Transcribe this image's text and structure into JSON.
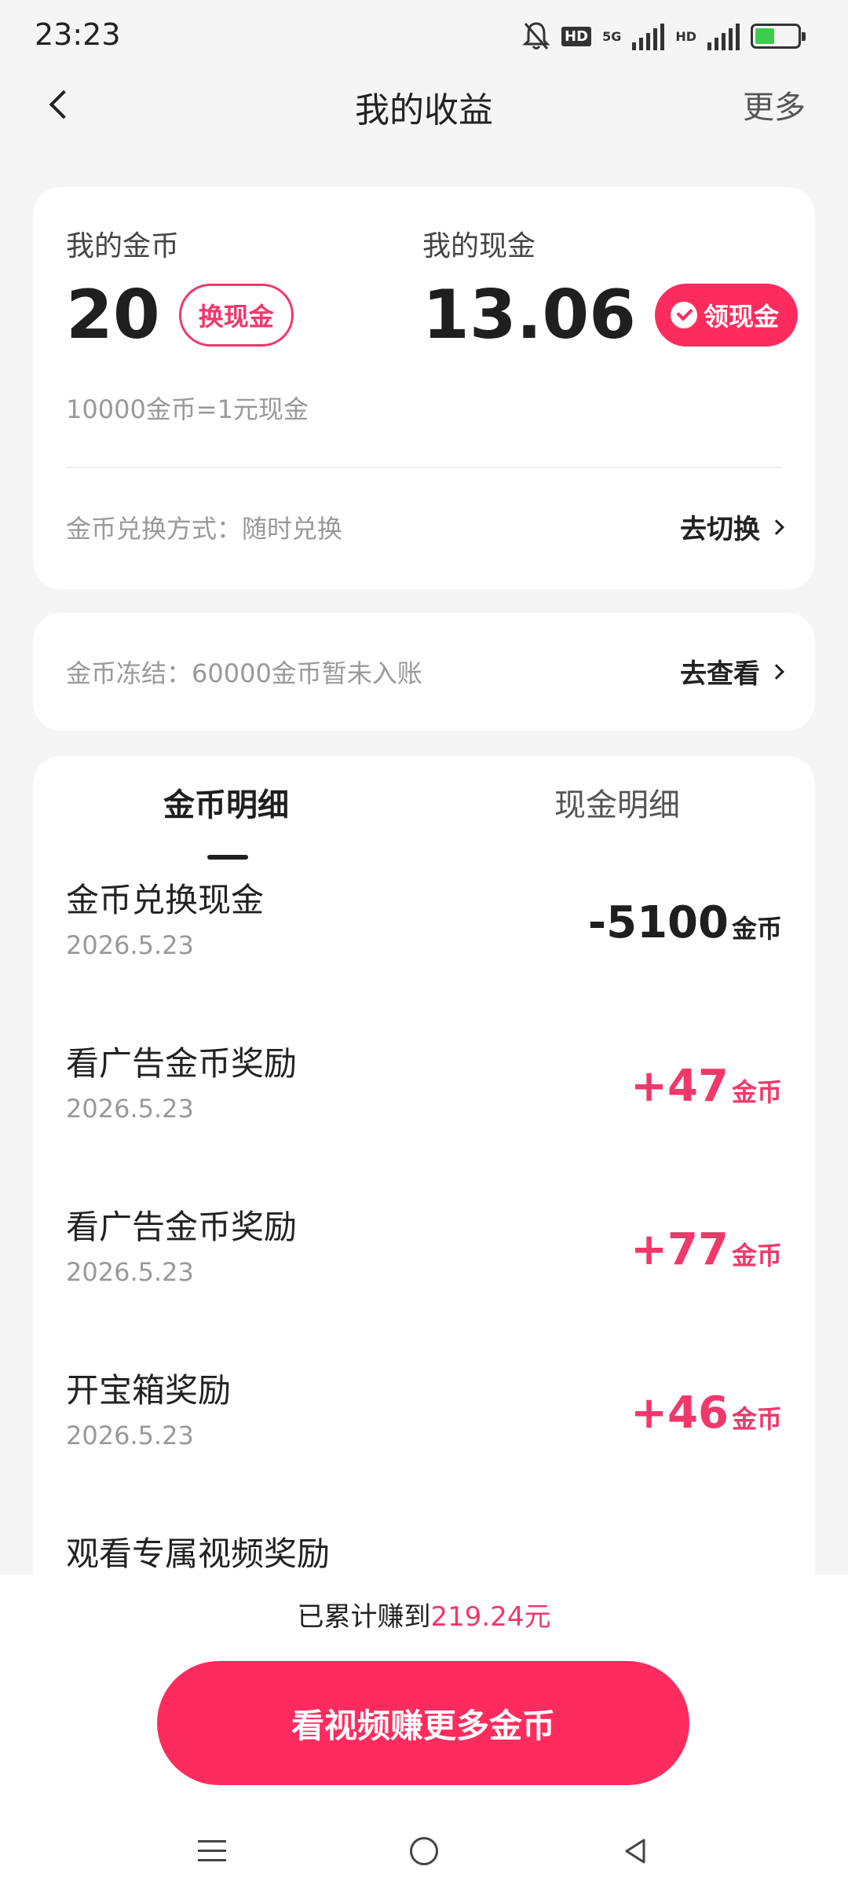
{
  "status_bar": {
    "time": "23:23",
    "hd_label": "HD",
    "network_label": "5G",
    "hd2_label": "HD"
  },
  "header": {
    "title": "我的收益",
    "more_label": "更多"
  },
  "earnings": {
    "coins_label": "我的金币",
    "coins_value": "20",
    "exchange_button": "换现金",
    "cash_label": "我的现金",
    "cash_value": "13.06",
    "withdraw_button": "领现金",
    "rate_text": "10000金币=1元现金",
    "exchange_mode_text": "金币兑换方式：随时兑换",
    "switch_link": "去切换"
  },
  "frozen": {
    "text": "金币冻结：60000金币暂未入账",
    "view_link": "去查看"
  },
  "detail": {
    "tabs": [
      {
        "label": "金币明细"
      },
      {
        "label": "现金明细"
      }
    ],
    "items": [
      {
        "title": "金币兑换现金",
        "date": "2026.5.23",
        "value": "-5100",
        "unit": "金币"
      },
      {
        "title": "看广告金币奖励",
        "date": "2026.5.23",
        "value": "+47",
        "unit": "金币"
      },
      {
        "title": "看广告金币奖励",
        "date": "2026.5.23",
        "value": "+77",
        "unit": "金币"
      },
      {
        "title": "开宝箱奖励",
        "date": "2026.5.23",
        "value": "+46",
        "unit": "金币"
      },
      {
        "title": "观看专属视频奖励",
        "date": "",
        "value": "",
        "unit": ""
      }
    ]
  },
  "bottom": {
    "total_prefix": "已累计赚到",
    "total_amount": "219.24元",
    "cta_label": "看视频赚更多金币"
  },
  "colors": {
    "accent": "#fe2c5e",
    "accent_text": "#f0386b",
    "background": "#f5f5f5"
  }
}
